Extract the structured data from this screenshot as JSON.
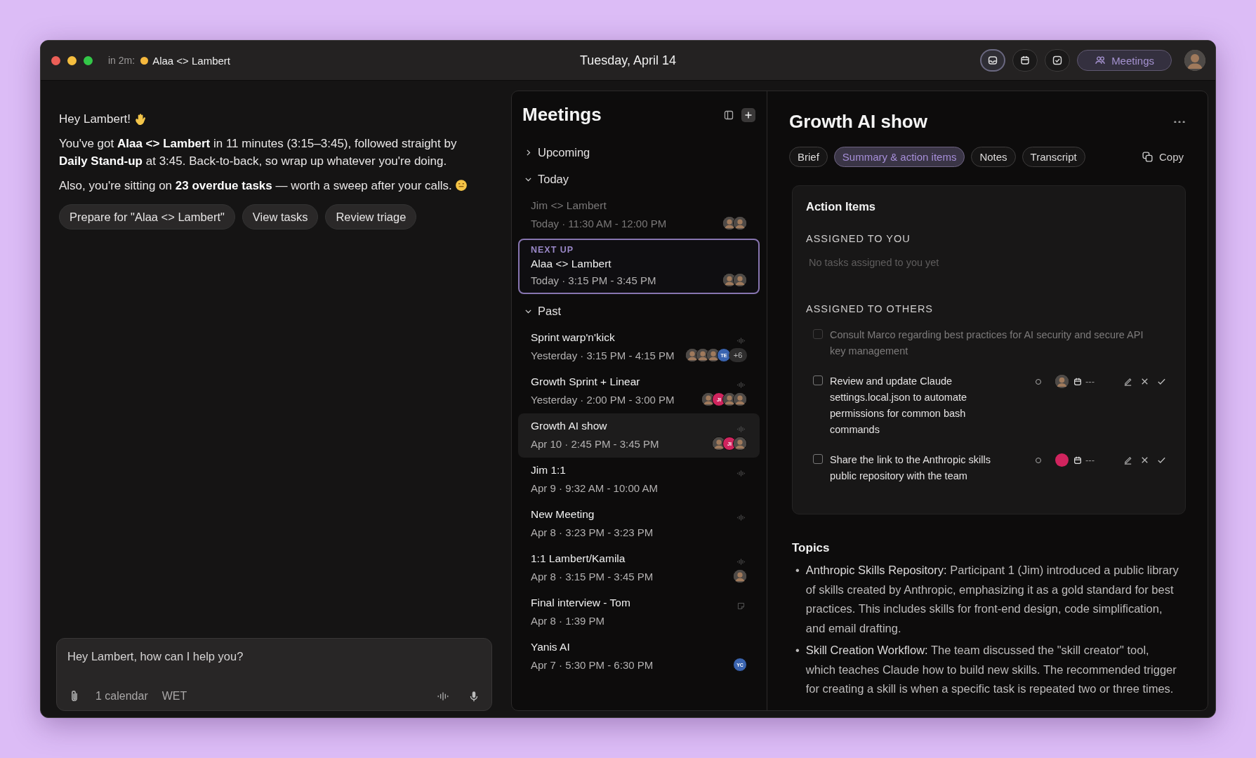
{
  "titlebar": {
    "countdown": "in 2m:",
    "next_meeting": "Alaa <> Lambert",
    "date": "Tuesday, April 14",
    "tools": [
      {
        "kind": "inbox",
        "selected": true
      },
      {
        "kind": "calendar",
        "selected": false
      },
      {
        "kind": "tasks",
        "selected": false
      }
    ],
    "meetings_button": {
      "label": "Meetings",
      "selected": true
    }
  },
  "assistant": {
    "greeting": "Hey Lambert!",
    "paragraphs": [
      {
        "text": "You've got **Alaa <> Lambert** in 11 minutes (3:15–3:45), followed straight by **Daily Stand-up** at 3:45. Back-to-back, so wrap up whatever you're doing."
      },
      {
        "text": "Also, you're sitting on **23 overdue tasks** — worth a sweep after your calls."
      }
    ],
    "suggestions": [
      "Prepare for \"Alaa <> Lambert\"",
      "View tasks",
      "Review triage"
    ],
    "composer": {
      "placeholder": "Hey Lambert, how can I help you?",
      "chips": [
        "1 calendar",
        "WET"
      ]
    }
  },
  "meetings": {
    "title": "Meetings",
    "sections": [
      {
        "label": "Upcoming",
        "expanded": false
      },
      {
        "label": "Today",
        "expanded": true,
        "items": [
          {
            "kind": "plain",
            "title": "Jim <> Lambert",
            "when": "Today · 11:30 AM - 12:00 PM",
            "dimmed": true,
            "selected": false,
            "avatars": [
              {
                "kind": "photo"
              },
              {
                "kind": "photo"
              }
            ]
          },
          {
            "kind": "plain",
            "label": "NEXT UP",
            "title": "Alaa <> Lambert",
            "when": "Today · 3:15 PM - 3:45 PM",
            "dimmed": false,
            "selected": false,
            "avatars": [
              {
                "kind": "photo"
              },
              {
                "kind": "photo"
              }
            ]
          }
        ]
      },
      {
        "label": "Past",
        "expanded": true,
        "items": [
          {
            "kind": "recording",
            "title": "Sprint warp'n'kick",
            "when": "Yesterday · 3:15 PM - 4:15 PM",
            "dimmed": false,
            "selected": false,
            "avatars": [
              {
                "kind": "photo"
              },
              {
                "kind": "photo"
              },
              {
                "kind": "photo"
              },
              {
                "kind": "initials",
                "initials": "TE",
                "color": "#3a64b0"
              }
            ],
            "more": "+6"
          },
          {
            "kind": "recording",
            "title": "Growth Sprint + Linear",
            "when": "Yesterday · 2:00 PM - 3:00 PM",
            "dimmed": false,
            "selected": false,
            "avatars": [
              {
                "kind": "photo"
              },
              {
                "kind": "initials",
                "initials": "JI",
                "color": "#d0245e"
              },
              {
                "kind": "photo"
              },
              {
                "kind": "photo"
              }
            ]
          },
          {
            "kind": "recording",
            "title": "Growth AI show",
            "when": "Apr 10 · 2:45 PM - 3:45 PM",
            "dimmed": false,
            "selected": true,
            "avatars": [
              {
                "kind": "photo"
              },
              {
                "kind": "initials",
                "initials": "JI",
                "color": "#d0245e"
              },
              {
                "kind": "photo"
              }
            ]
          },
          {
            "kind": "recording",
            "title": "Jim 1:1",
            "when": "Apr 9 · 9:32 AM - 10:00 AM",
            "dimmed": false,
            "selected": false
          },
          {
            "kind": "recording",
            "title": "New Meeting",
            "when": "Apr 8 · 3:23 PM - 3:23 PM",
            "dimmed": false,
            "selected": false
          },
          {
            "kind": "recording",
            "title": "1:1 Lambert/Kamila",
            "when": "Apr 8 · 3:15 PM - 3:45 PM",
            "dimmed": false,
            "selected": false,
            "avatars": [
              {
                "kind": "photo"
              }
            ]
          },
          {
            "kind": "note",
            "title": "Final interview - Tom",
            "when": "Apr 8 · 1:39 PM",
            "dimmed": false,
            "selected": false
          },
          {
            "kind": "plain",
            "title": "Yanis AI",
            "when": "Apr 7 · 5:30 PM - 6:30 PM",
            "dimmed": false,
            "selected": false,
            "avatars": [
              {
                "kind": "initials",
                "initials": "YC",
                "color": "#3a64b0"
              }
            ]
          }
        ]
      }
    ]
  },
  "detail": {
    "title": "Growth AI show",
    "tabs": [
      {
        "label": "Brief",
        "selected": false
      },
      {
        "label": "Summary & action items",
        "selected": true
      },
      {
        "label": "Notes",
        "selected": false
      },
      {
        "label": "Transcript",
        "selected": false
      }
    ],
    "copy": "Copy",
    "action_items": {
      "title": "Action Items",
      "groups": [
        {
          "label": "ASSIGNED TO YOU",
          "empty_text": "No tasks assigned to you yet"
        },
        {
          "label": "ASSIGNED TO OTHERS",
          "tasks": [
            {
              "text": "Consult Marco regarding best practices for AI security and secure API key management",
              "checked": false,
              "dimmed": true
            },
            {
              "text": "Review and update Claude settings.local.json to automate permissions for common bash commands",
              "checked": false,
              "dimmed": false,
              "assignee": {
                "kind": "photo"
              },
              "due": "---"
            },
            {
              "text": "Share the link to the Anthropic skills public repository with the team",
              "checked": false,
              "dimmed": false,
              "assignee": {
                "kind": "initials",
                "color": "#d0245e"
              },
              "due": "---"
            }
          ]
        }
      ]
    },
    "topics": {
      "title": "Topics",
      "items": [
        {
          "bullet": "•",
          "term": "Anthropic Skills Repository:",
          "text": "Participant 1 (Jim) introduced a public library of skills created by Anthropic, emphasizing it as a gold standard for best practices. This includes skills for front-end design, code simplification, and email drafting."
        },
        {
          "bullet": "•",
          "term": "Skill Creation Workflow:",
          "text": "The team discussed the \"skill creator\" tool, which teaches Claude how to build new skills. The recommended trigger for creating a skill is when a specific task is repeated two or three times."
        }
      ]
    }
  }
}
